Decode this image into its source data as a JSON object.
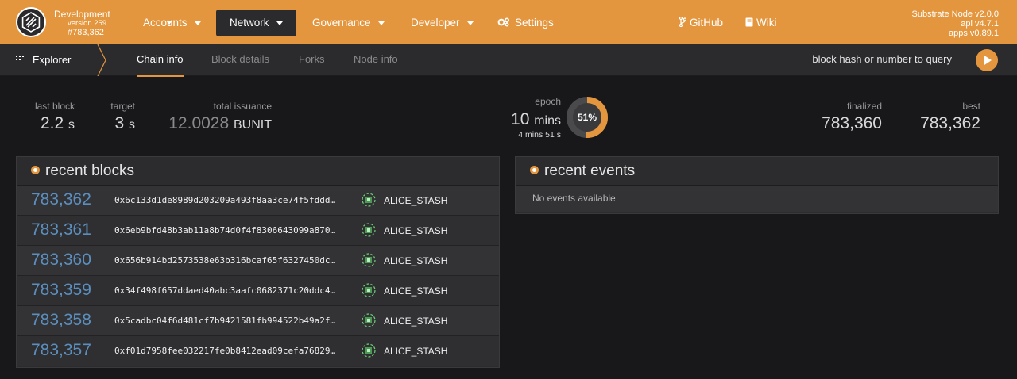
{
  "header": {
    "chain_name": "Development",
    "chain_version": "version 259",
    "chain_block": "#783,362",
    "nav": [
      {
        "label": "Accounts",
        "has_caret": true
      },
      {
        "label": "Network",
        "has_caret": true,
        "active": true
      },
      {
        "label": "Governance",
        "has_caret": true
      },
      {
        "label": "Developer",
        "has_caret": true
      },
      {
        "label": "Settings",
        "icon": "gears-icon"
      },
      {
        "label": "GitHub",
        "icon": "code-branch-icon"
      },
      {
        "label": "Wiki",
        "icon": "book-icon"
      }
    ],
    "node_info": {
      "node": "Substrate Node v2.0.0",
      "api": "api v4.7.1",
      "apps": "apps v0.89.1"
    },
    "accent_color": "#e3963e"
  },
  "subnav": {
    "app_label": "Explorer",
    "tabs": [
      {
        "label": "Chain info",
        "active": true
      },
      {
        "label": "Block details"
      },
      {
        "label": "Forks"
      },
      {
        "label": "Node info"
      }
    ],
    "query_placeholder": "block hash or number to query"
  },
  "summary": {
    "last_block": {
      "label": "last block",
      "value": "2.2",
      "unit": "s"
    },
    "target": {
      "label": "target",
      "value": "3",
      "unit": "s"
    },
    "total_issuance": {
      "label": "total issuance",
      "value_main": "12.",
      "value_dim": "0028",
      "unit": "BUNIT"
    },
    "epoch": {
      "label": "epoch",
      "value": "10",
      "unit": "mins",
      "sub": "4 mins 51 s",
      "progress_label": "51%",
      "progress": 0.51
    },
    "finalized": {
      "label": "finalized",
      "value": "783,360"
    },
    "best": {
      "label": "best",
      "value": "783,362"
    }
  },
  "recent_blocks": {
    "title": "recent blocks",
    "rows": [
      {
        "number": "783,362",
        "hash": "0x6c133d1de8989d203209a493f8aa3ce74f5fddd…",
        "author": "ALICE_STASH"
      },
      {
        "number": "783,361",
        "hash": "0x6eb9bfd48b3ab11a8b74d0f4f8306643099a870…",
        "author": "ALICE_STASH"
      },
      {
        "number": "783,360",
        "hash": "0x656b914bd2573538e63b316bcaf65f6327450dc…",
        "author": "ALICE_STASH"
      },
      {
        "number": "783,359",
        "hash": "0x34f498f657ddaed40abc3aafc0682371c20ddc4…",
        "author": "ALICE_STASH"
      },
      {
        "number": "783,358",
        "hash": "0x5cadbc04f6d481cf7b9421581fb994522b49a2f…",
        "author": "ALICE_STASH"
      },
      {
        "number": "783,357",
        "hash": "0xf01d7958fee032217fe0b8412ead09cefa76829…",
        "author": "ALICE_STASH"
      }
    ]
  },
  "recent_events": {
    "title": "recent events",
    "empty_text": "No events available"
  }
}
